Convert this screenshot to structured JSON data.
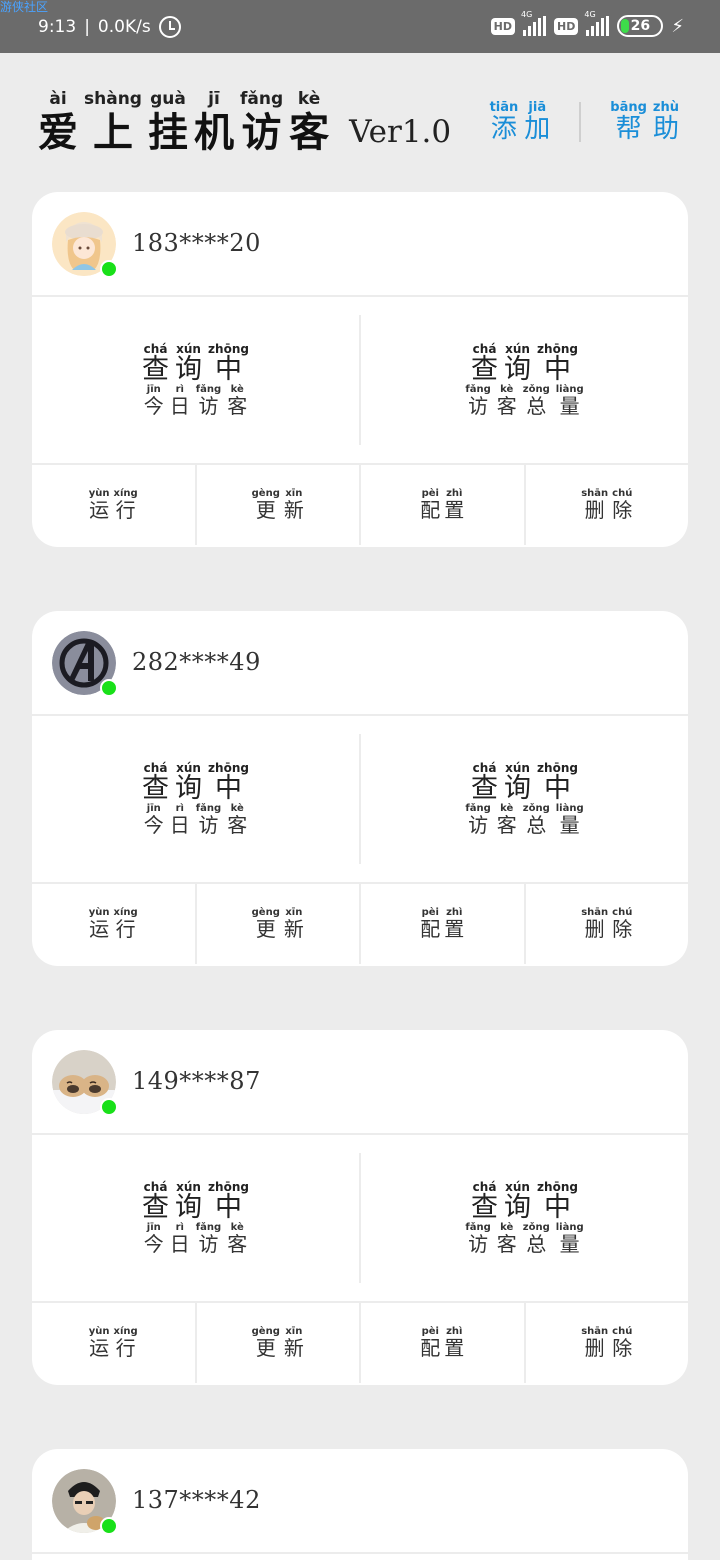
{
  "status_bar": {
    "watermark": "游侠社区",
    "time": "9:13",
    "separator": "|",
    "net_speed": "0.0K/s",
    "hd1": "HD",
    "net1": "4G",
    "hd2": "HD",
    "net2": "4G",
    "battery": "26"
  },
  "header": {
    "title": [
      {
        "py": "ài",
        "hz": "爱"
      },
      {
        "py": "shàng",
        "hz": "上"
      },
      {
        "py": "guà",
        "hz": "挂"
      },
      {
        "py": "jī",
        "hz": "机"
      },
      {
        "py": "fǎng",
        "hz": "访"
      },
      {
        "py": "kè",
        "hz": "客"
      }
    ],
    "version": "Ver1.0",
    "add": [
      {
        "py": "tiān",
        "hz": "添"
      },
      {
        "py": "jiā",
        "hz": "加"
      }
    ],
    "help": [
      {
        "py": "bāng",
        "hz": "帮"
      },
      {
        "py": "zhù",
        "hz": "助"
      }
    ]
  },
  "labels": {
    "querying": [
      {
        "py": "chá",
        "hz": "查"
      },
      {
        "py": "xún",
        "hz": "询"
      },
      {
        "py": "zhōng",
        "hz": "中"
      }
    ],
    "today_visitors": [
      {
        "py": "jīn",
        "hz": "今"
      },
      {
        "py": "rì",
        "hz": "日"
      },
      {
        "py": "fǎng",
        "hz": "访"
      },
      {
        "py": "kè",
        "hz": "客"
      }
    ],
    "total_visitors": [
      {
        "py": "fǎng",
        "hz": "访"
      },
      {
        "py": "kè",
        "hz": "客"
      },
      {
        "py": "zǒng",
        "hz": "总"
      },
      {
        "py": "liàng",
        "hz": "量"
      }
    ],
    "run": [
      {
        "py": "yùn",
        "hz": "运"
      },
      {
        "py": "xíng",
        "hz": "行"
      }
    ],
    "update": [
      {
        "py": "gèng",
        "hz": "更"
      },
      {
        "py": "xīn",
        "hz": "新"
      }
    ],
    "config": [
      {
        "py": "pèi",
        "hz": "配"
      },
      {
        "py": "zhì",
        "hz": "置"
      }
    ],
    "delete": [
      {
        "py": "shān",
        "hz": "删"
      },
      {
        "py": "chú",
        "hz": "除"
      }
    ]
  },
  "accounts": [
    {
      "number": "183****20",
      "avatar": "anime-girl-avatar",
      "online_color": "#19e019"
    },
    {
      "number": "282****49",
      "avatar": "avengers-logo-avatar",
      "online_color": "#19e019"
    },
    {
      "number": "149****87",
      "avatar": "dogs-avatar",
      "online_color": "#19e019"
    },
    {
      "number": "137****42",
      "avatar": "person-with-dog-avatar",
      "online_color": "#19e019"
    }
  ],
  "colors": {
    "accent": "#1a8ed8",
    "online": "#19e019",
    "background": "#ececec"
  }
}
